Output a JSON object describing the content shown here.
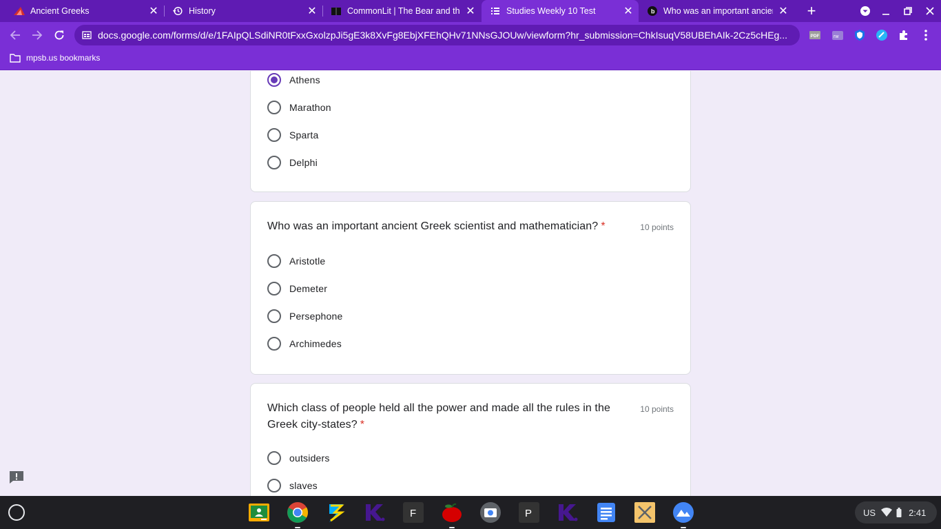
{
  "browser": {
    "tabs": [
      {
        "title": "Ancient Greeks",
        "favicon": "red-wedge-icon",
        "active": false
      },
      {
        "title": "History",
        "favicon": "history-icon",
        "active": false
      },
      {
        "title": "CommonLit | The Bear and the Bee",
        "favicon": "book-icon",
        "active": false
      },
      {
        "title": "Studies Weekly 10 Test",
        "favicon": "forms-icon",
        "active": true
      },
      {
        "title": "Who was an important ancient Greek",
        "favicon": "brainly-icon",
        "active": false
      }
    ],
    "url": "docs.google.com/forms/d/e/1FAIpQLSdiNR0tFxxGxolzpJi5gE3k8XvFg8EbjXFEhQHv71NNsGJOUw/viewform?hr_submission=ChkIsuqV58UBEhAIk-2Cz5cHEg...",
    "bookmark_folder": "mpsb.us bookmarks",
    "extensions": [
      "pdf-icon",
      "kami-icon",
      "shield-icon",
      "speedometer-icon",
      "puzzle-icon"
    ]
  },
  "form": {
    "partial_question": {
      "options": [
        {
          "label": "Athens",
          "checked": true
        },
        {
          "label": "Marathon",
          "checked": false
        },
        {
          "label": "Sparta",
          "checked": false
        },
        {
          "label": "Delphi",
          "checked": false
        }
      ]
    },
    "questions": [
      {
        "title": "Who was an important ancient Greek scientist and mathematician?",
        "required_mark": "*",
        "points": "10 points",
        "options": [
          {
            "label": "Aristotle",
            "checked": false
          },
          {
            "label": "Demeter",
            "checked": false
          },
          {
            "label": "Persephone",
            "checked": false
          },
          {
            "label": "Archimedes",
            "checked": false
          }
        ]
      },
      {
        "title_line1": "Which class of people held all the power and made all the rules in the",
        "title_line2": "Greek city-states?",
        "required_mark": "*",
        "points": "10 points",
        "options": [
          {
            "label": "outsiders",
            "checked": false
          },
          {
            "label": "slaves",
            "checked": false
          }
        ]
      }
    ]
  },
  "shelf": {
    "apps": [
      "classroom-icon",
      "chrome-icon",
      "zulu-icon",
      "kahoot-icon",
      "f-app-icon",
      "apple-icon",
      "camera-icon",
      "p-app-icon",
      "kahoot-icon-2",
      "docs-icon",
      "x-app-icon",
      "gallery-icon"
    ],
    "ime": "US",
    "time": "2:41"
  },
  "colors": {
    "chrome_dark": "#5f1bb3",
    "chrome_light": "#7a2fd6",
    "form_bg": "#f0ebf8",
    "radio_accent": "#673ab7",
    "required": "#d93025"
  }
}
